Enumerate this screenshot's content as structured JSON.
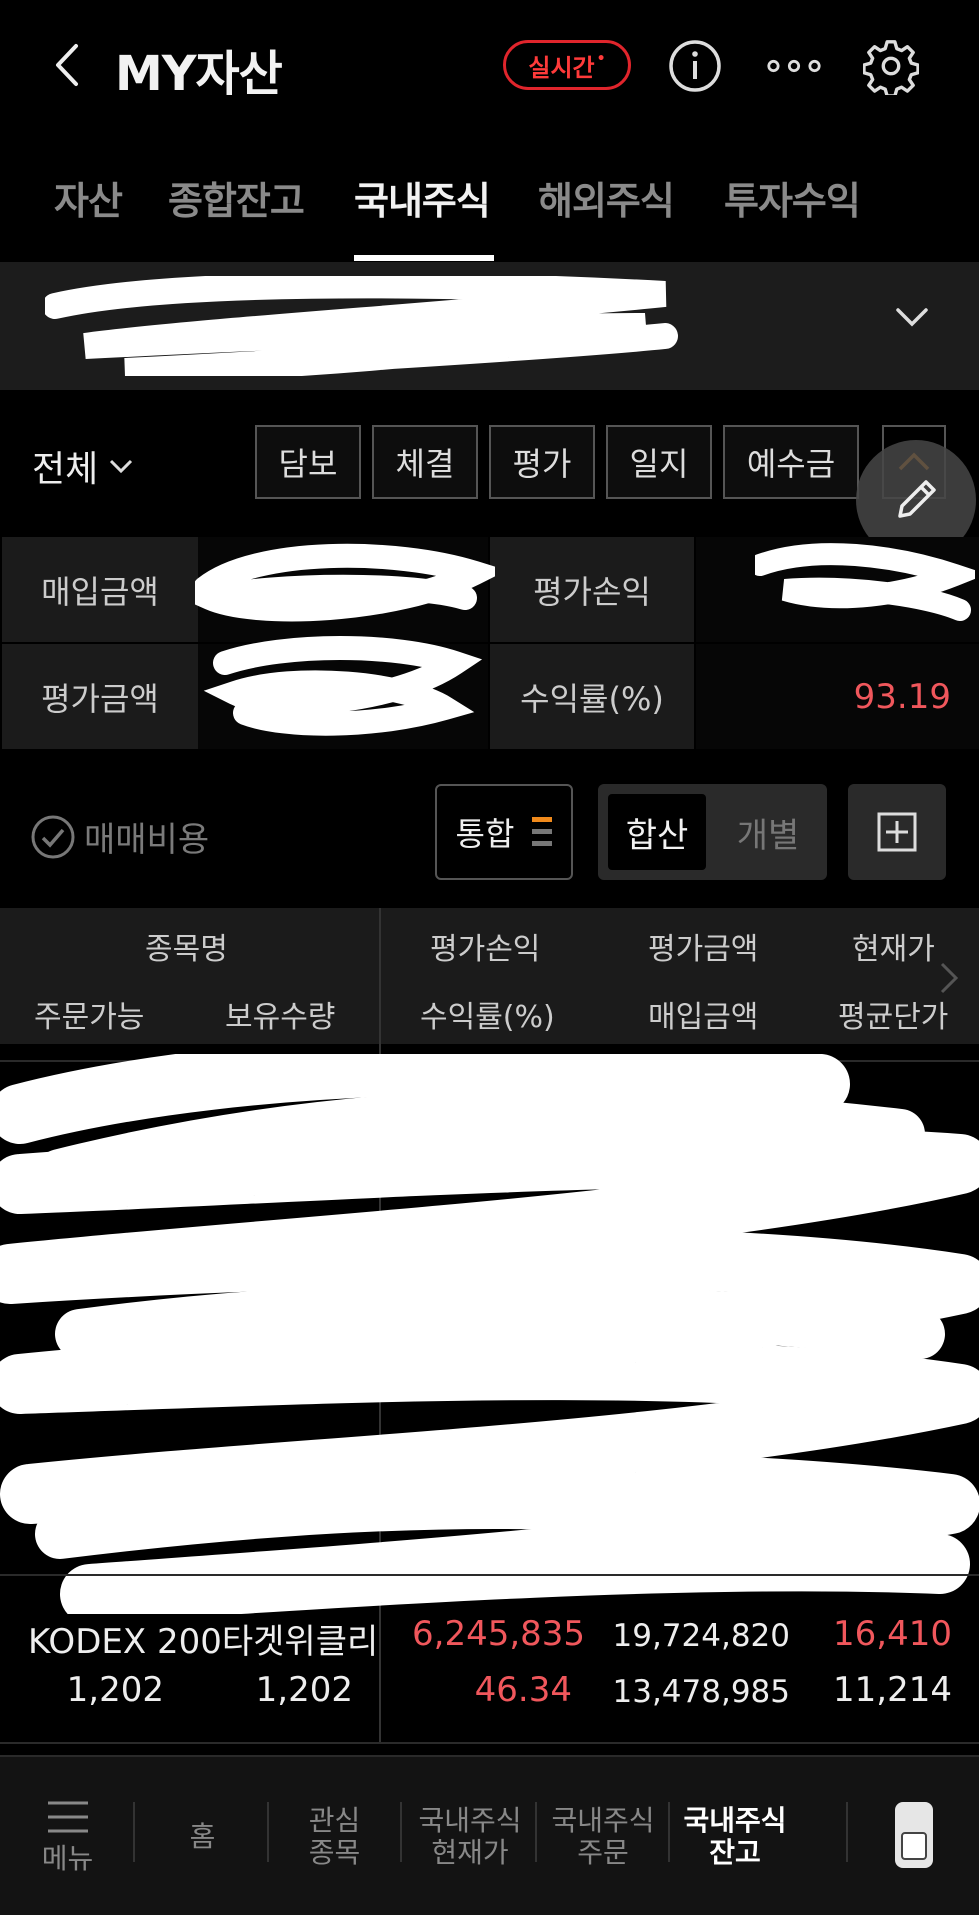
{
  "header": {
    "title": "MY자산",
    "realtime_label": "실시간",
    "realtime_mark": "•"
  },
  "tabs": [
    {
      "label": "자산",
      "active": false
    },
    {
      "label": "종합잔고",
      "active": false
    },
    {
      "label": "국내주식",
      "active": true
    },
    {
      "label": "해외주식",
      "active": false
    },
    {
      "label": "투자수익",
      "active": false
    }
  ],
  "account": {
    "text": "",
    "redacted": true
  },
  "filters": {
    "scope": "전체",
    "buttons": [
      "담보",
      "체결",
      "평가",
      "일지",
      "예수금"
    ]
  },
  "summary": {
    "purchase_label": "매입금액",
    "purchase_value": "",
    "pnl_label": "평가손익",
    "pnl_value": "",
    "eval_label": "평가금액",
    "eval_value": "",
    "return_label": "수익률(%)",
    "return_value": "93.19"
  },
  "toolbar": {
    "fee_label": "매매비용",
    "combined_label": "통합",
    "seg_sum": "합산",
    "seg_each": "개별"
  },
  "table": {
    "headers_row1": [
      "종목명",
      "평가손익",
      "평가금액",
      "현재가"
    ],
    "headers_row2": [
      "주문가능",
      "보유수량",
      "수익률(%)",
      "매입금액",
      "평균단가"
    ],
    "rows": [
      {
        "name": "KODEX 200타겟위클리",
        "pnl": "6,245,835",
        "eval_amount": "19,724,820",
        "price": "16,410",
        "orderable": "1,202",
        "quantity": "1,202",
        "return_pct": "46.34",
        "purchase_amount": "13,478,985",
        "avg_price": "11,214"
      }
    ]
  },
  "bottom_nav": {
    "menu_label": "메뉴",
    "items": [
      {
        "line1": "홈",
        "line2": "",
        "active": false
      },
      {
        "line1": "관심",
        "line2": "종목",
        "active": false
      },
      {
        "line1": "국내주식",
        "line2": "현재가",
        "active": false
      },
      {
        "line1": "국내주식",
        "line2": "주문",
        "active": false
      },
      {
        "line1": "국내주식",
        "line2": "잔고",
        "active": true
      }
    ]
  },
  "colors": {
    "background": "#000000",
    "accent_red": "#f0575c",
    "realtime_red": "#e0252c",
    "header_cell": "#1b1b1b"
  }
}
